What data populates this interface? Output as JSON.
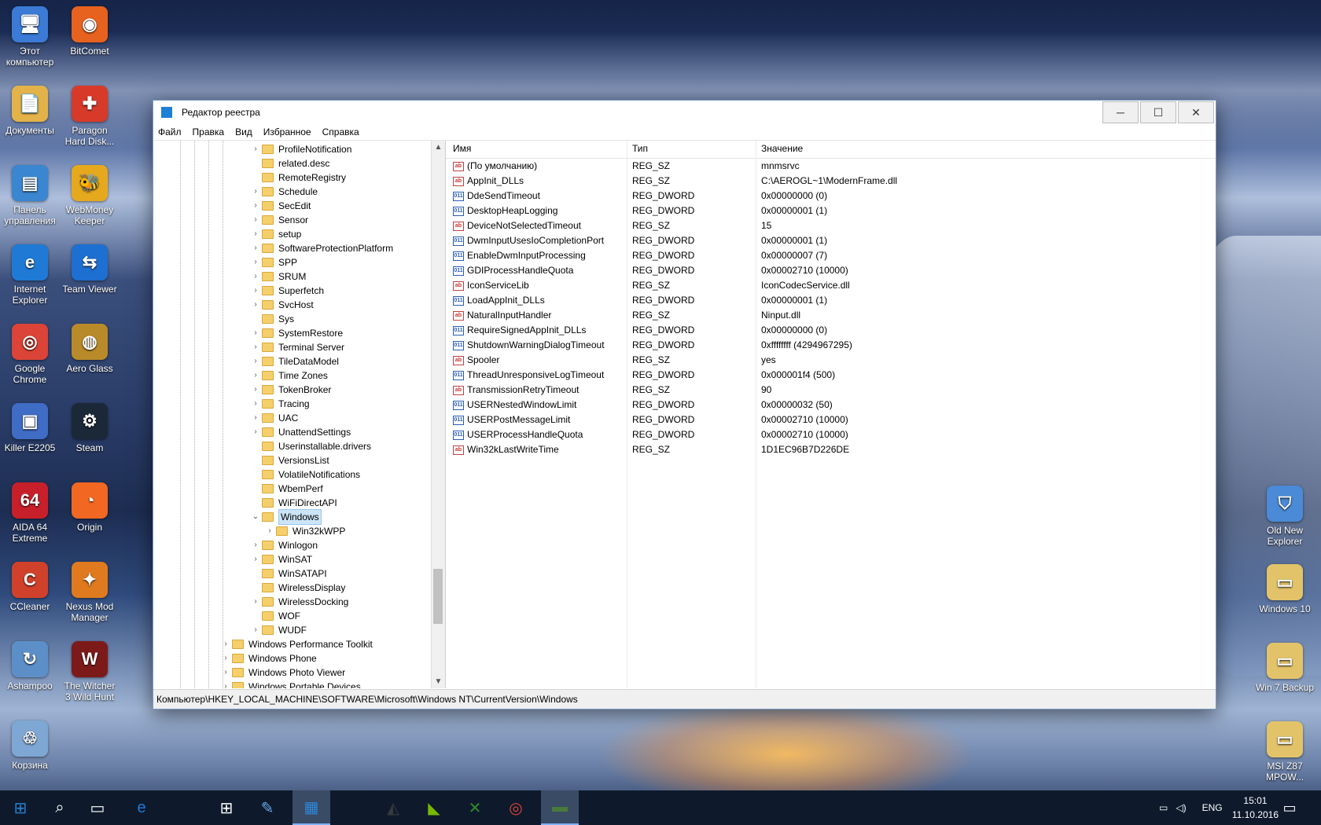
{
  "desktop": {
    "left_icons": [
      {
        "label1": "Этот",
        "label2": "компьютер",
        "glyph": "🖥",
        "color": "#3b7bd6",
        "icon": "computer-icon"
      },
      {
        "label1": "BitComet",
        "label2": "",
        "glyph": "◉",
        "color": "#e8621f",
        "icon": "bitcomet-icon"
      },
      {
        "label1": "Документы",
        "label2": "",
        "glyph": "📄",
        "color": "#e3b34a",
        "icon": "documents-icon"
      },
      {
        "label1": "Paragon",
        "label2": "Hard Disk...",
        "glyph": "✚",
        "color": "#d83a2a",
        "icon": "paragon-icon"
      },
      {
        "label1": "Панель",
        "label2": "управления",
        "glyph": "▤",
        "color": "#3a86d0",
        "icon": "control-panel-icon"
      },
      {
        "label1": "WebMoney",
        "label2": "Keeper",
        "glyph": "🐝",
        "color": "#e6a91e",
        "icon": "webmoney-icon"
      },
      {
        "label1": "Internet",
        "label2": "Explorer",
        "glyph": "e",
        "color": "#1f7ad6",
        "icon": "internet-explorer-icon"
      },
      {
        "label1": "Team Viewer",
        "label2": "",
        "glyph": "⇆",
        "color": "#1d6fd1",
        "icon": "teamviewer-icon"
      },
      {
        "label1": "Google",
        "label2": "Chrome",
        "glyph": "◎",
        "color": "#db4437",
        "icon": "chrome-icon"
      },
      {
        "label1": "Aero Glass",
        "label2": "",
        "glyph": "◍",
        "color": "#b98a2a",
        "icon": "aero-glass-icon"
      },
      {
        "label1": "Killer E2205",
        "label2": "",
        "glyph": "▣",
        "color": "#3f6cc4",
        "icon": "killer-network-icon"
      },
      {
        "label1": "Steam",
        "label2": "",
        "glyph": "⚙",
        "color": "#1b2838",
        "icon": "steam-icon"
      },
      {
        "label1": "AIDA 64",
        "label2": "Extreme",
        "glyph": "64",
        "color": "#c8202a",
        "icon": "aida64-icon"
      },
      {
        "label1": "Origin",
        "label2": "",
        "glyph": "◔",
        "color": "#f26722",
        "icon": "origin-icon"
      },
      {
        "label1": "CCleaner",
        "label2": "",
        "glyph": "C",
        "color": "#d0412b",
        "icon": "ccleaner-icon"
      },
      {
        "label1": "Nexus Mod",
        "label2": "Manager",
        "glyph": "✦",
        "color": "#e07a1f",
        "icon": "nexus-mod-manager-icon"
      },
      {
        "label1": "Ashampoo",
        "label2": "",
        "glyph": "↻",
        "color": "#5c8fc8",
        "icon": "ashampoo-icon"
      },
      {
        "label1": "The Witcher",
        "label2": "3 Wild Hunt",
        "glyph": "W",
        "color": "#7c1a1a",
        "icon": "witcher-icon"
      },
      {
        "label1": "Корзина",
        "label2": "",
        "glyph": "♲",
        "color": "#7fa7d3",
        "icon": "recycle-bin-icon"
      }
    ],
    "right_icons": [
      {
        "label1": "Old New",
        "label2": "Explorer",
        "glyph": "⛉",
        "color": "#4a8ad6",
        "icon": "old-new-explorer-icon"
      },
      {
        "label1": "Windows 10",
        "label2": "",
        "glyph": "▭",
        "color": "#e3c36a",
        "icon": "folder-icon"
      },
      {
        "label1": "Win 7 Backup",
        "label2": "",
        "glyph": "▭",
        "color": "#e3c36a",
        "icon": "folder-icon"
      },
      {
        "label1": "MSI Z87",
        "label2": "MPOW...",
        "glyph": "▭",
        "color": "#e3c36a",
        "icon": "folder-icon"
      }
    ]
  },
  "window": {
    "title": "Редактор реестра",
    "menu": [
      "Файл",
      "Правка",
      "Вид",
      "Избранное",
      "Справка"
    ],
    "tree": [
      {
        "label": "ProfileNotification",
        "level": 1,
        "exp": true
      },
      {
        "label": "related.desc",
        "level": 1,
        "exp": false
      },
      {
        "label": "RemoteRegistry",
        "level": 1,
        "exp": false
      },
      {
        "label": "Schedule",
        "level": 1,
        "exp": true
      },
      {
        "label": "SecEdit",
        "level": 1,
        "exp": true
      },
      {
        "label": "Sensor",
        "level": 1,
        "exp": true
      },
      {
        "label": "setup",
        "level": 1,
        "exp": true
      },
      {
        "label": "SoftwareProtectionPlatform",
        "level": 1,
        "exp": true
      },
      {
        "label": "SPP",
        "level": 1,
        "exp": true
      },
      {
        "label": "SRUM",
        "level": 1,
        "exp": true
      },
      {
        "label": "Superfetch",
        "level": 1,
        "exp": true
      },
      {
        "label": "SvcHost",
        "level": 1,
        "exp": true
      },
      {
        "label": "Sys",
        "level": 1,
        "exp": false
      },
      {
        "label": "SystemRestore",
        "level": 1,
        "exp": true
      },
      {
        "label": "Terminal Server",
        "level": 1,
        "exp": true
      },
      {
        "label": "TileDataModel",
        "level": 1,
        "exp": true
      },
      {
        "label": "Time Zones",
        "level": 1,
        "exp": true
      },
      {
        "label": "TokenBroker",
        "level": 1,
        "exp": true
      },
      {
        "label": "Tracing",
        "level": 1,
        "exp": true
      },
      {
        "label": "UAC",
        "level": 1,
        "exp": true
      },
      {
        "label": "UnattendSettings",
        "level": 1,
        "exp": true
      },
      {
        "label": "Userinstallable.drivers",
        "level": 1,
        "exp": false
      },
      {
        "label": "VersionsList",
        "level": 1,
        "exp": false
      },
      {
        "label": "VolatileNotifications",
        "level": 1,
        "exp": false
      },
      {
        "label": "WbemPerf",
        "level": 1,
        "exp": false
      },
      {
        "label": "WiFiDirectAPI",
        "level": 1,
        "exp": false
      },
      {
        "label": "Windows",
        "level": 1,
        "exp": "open",
        "selected": true
      },
      {
        "label": "Win32kWPP",
        "level": 2,
        "exp": true
      },
      {
        "label": "Winlogon",
        "level": 1,
        "exp": true
      },
      {
        "label": "WinSAT",
        "level": 1,
        "exp": true
      },
      {
        "label": "WinSATAPI",
        "level": 1,
        "exp": false
      },
      {
        "label": "WirelessDisplay",
        "level": 1,
        "exp": false
      },
      {
        "label": "WirelessDocking",
        "level": 1,
        "exp": true
      },
      {
        "label": "WOF",
        "level": 1,
        "exp": false
      },
      {
        "label": "WUDF",
        "level": 1,
        "exp": true
      },
      {
        "label": "Windows Performance Toolkit",
        "level": 0,
        "exp": true
      },
      {
        "label": "Windows Phone",
        "level": 0,
        "exp": true
      },
      {
        "label": "Windows Photo Viewer",
        "level": 0,
        "exp": true
      },
      {
        "label": "Windows Portable Devices",
        "level": 0,
        "exp": true
      }
    ],
    "columns": {
      "name": "Имя",
      "type": "Тип",
      "value": "Значение"
    },
    "values": [
      {
        "name": "(По умолчанию)",
        "type": "REG_SZ",
        "data": "mnmsrvc",
        "kind": "sz"
      },
      {
        "name": "AppInit_DLLs",
        "type": "REG_SZ",
        "data": "C:\\AEROGL~1\\ModernFrame.dll",
        "kind": "sz"
      },
      {
        "name": "DdeSendTimeout",
        "type": "REG_DWORD",
        "data": "0x00000000 (0)",
        "kind": "dw"
      },
      {
        "name": "DesktopHeapLogging",
        "type": "REG_DWORD",
        "data": "0x00000001 (1)",
        "kind": "dw"
      },
      {
        "name": "DeviceNotSelectedTimeout",
        "type": "REG_SZ",
        "data": "15",
        "kind": "sz"
      },
      {
        "name": "DwmInputUsesIoCompletionPort",
        "type": "REG_DWORD",
        "data": "0x00000001 (1)",
        "kind": "dw"
      },
      {
        "name": "EnableDwmInputProcessing",
        "type": "REG_DWORD",
        "data": "0x00000007 (7)",
        "kind": "dw"
      },
      {
        "name": "GDIProcessHandleQuota",
        "type": "REG_DWORD",
        "data": "0x00002710 (10000)",
        "kind": "dw"
      },
      {
        "name": "IconServiceLib",
        "type": "REG_SZ",
        "data": "IconCodecService.dll",
        "kind": "sz"
      },
      {
        "name": "LoadAppInit_DLLs",
        "type": "REG_DWORD",
        "data": "0x00000001 (1)",
        "kind": "dw"
      },
      {
        "name": "NaturalInputHandler",
        "type": "REG_SZ",
        "data": "Ninput.dll",
        "kind": "sz"
      },
      {
        "name": "RequireSignedAppInit_DLLs",
        "type": "REG_DWORD",
        "data": "0x00000000 (0)",
        "kind": "dw"
      },
      {
        "name": "ShutdownWarningDialogTimeout",
        "type": "REG_DWORD",
        "data": "0xffffffff (4294967295)",
        "kind": "dw"
      },
      {
        "name": "Spooler",
        "type": "REG_SZ",
        "data": "yes",
        "kind": "sz"
      },
      {
        "name": "ThreadUnresponsiveLogTimeout",
        "type": "REG_DWORD",
        "data": "0x000001f4 (500)",
        "kind": "dw"
      },
      {
        "name": "TransmissionRetryTimeout",
        "type": "REG_SZ",
        "data": "90",
        "kind": "sz"
      },
      {
        "name": "USERNestedWindowLimit",
        "type": "REG_DWORD",
        "data": "0x00000032 (50)",
        "kind": "dw"
      },
      {
        "name": "USERPostMessageLimit",
        "type": "REG_DWORD",
        "data": "0x00002710 (10000)",
        "kind": "dw"
      },
      {
        "name": "USERProcessHandleQuota",
        "type": "REG_DWORD",
        "data": "0x00002710 (10000)",
        "kind": "dw"
      },
      {
        "name": "Win32kLastWriteTime",
        "type": "REG_SZ",
        "data": "1D1EC96B7D226DE",
        "kind": "sz"
      }
    ],
    "value_icon_sz": "ab",
    "value_icon_dw": "011",
    "status_path": "Компьютер\\HKEY_LOCAL_MACHINE\\SOFTWARE\\Microsoft\\Windows NT\\CurrentVersion\\Windows"
  },
  "taskbar": {
    "apps": [
      {
        "icon": "start-icon",
        "color": "#2a7fd6",
        "glyph": "⊞"
      },
      {
        "icon": "search-icon",
        "color": "",
        "glyph": "⌕"
      },
      {
        "icon": "task-view-icon",
        "color": "",
        "glyph": "▭"
      },
      {
        "icon": "edge-icon",
        "color": "#1f7ad6",
        "glyph": "e"
      },
      {
        "icon": "file-explorer-icon",
        "color": "#e3b34a",
        "glyph": ""
      },
      {
        "icon": "store-icon",
        "color": "#ffffff",
        "glyph": "⊞"
      },
      {
        "icon": "paint-icon",
        "color": "#6aa6e0",
        "glyph": "✎"
      },
      {
        "icon": "regedit-icon",
        "color": "#2f86d8",
        "glyph": "▦",
        "active": true
      },
      {
        "icon": "control-panel-icon",
        "color": "#d8a84a",
        "glyph": ""
      },
      {
        "icon": "hwinfo-icon",
        "color": "#3a3a3a",
        "glyph": "◭"
      },
      {
        "icon": "nvidia-icon",
        "color": "#76b900",
        "glyph": "◣"
      },
      {
        "icon": "xbox-icon",
        "color": "#2b8a2b",
        "glyph": "✕"
      },
      {
        "icon": "chrome-icon",
        "color": "#db4437",
        "glyph": "◎"
      },
      {
        "icon": "usb-icon",
        "color": "#4a7a3a",
        "glyph": "▬",
        "active": true
      }
    ],
    "lang": "ENG",
    "time": "15:01",
    "date": "11.10.2016"
  }
}
